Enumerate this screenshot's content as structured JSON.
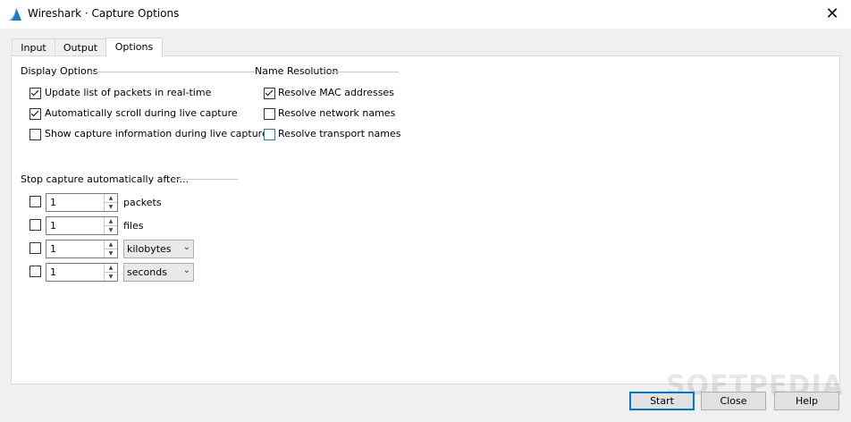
{
  "window": {
    "title": "Wireshark · Capture Options",
    "icon": "wireshark-fin-icon",
    "close_label": "✕"
  },
  "tabs": [
    {
      "label": "Input",
      "active": false
    },
    {
      "label": "Output",
      "active": false
    },
    {
      "label": "Options",
      "active": true
    }
  ],
  "display_options": {
    "title": "Display Options",
    "items": [
      {
        "label": "Update list of packets in real-time",
        "checked": true
      },
      {
        "label": "Automatically scroll during live capture",
        "checked": true
      },
      {
        "label": "Show capture information during live capture",
        "checked": false
      }
    ]
  },
  "name_resolution": {
    "title": "Name Resolution",
    "items": [
      {
        "label": "Resolve MAC addresses",
        "checked": true
      },
      {
        "label": "Resolve network names",
        "checked": false
      },
      {
        "label": "Resolve transport names",
        "checked": false
      }
    ]
  },
  "stop_capture": {
    "title": "Stop capture automatically after...",
    "rows": [
      {
        "checked": false,
        "value": "1",
        "unit": "packets"
      },
      {
        "checked": false,
        "value": "1",
        "unit": "files"
      },
      {
        "checked": false,
        "value": "1",
        "unit": "kilobytes",
        "unit_is_select": true
      },
      {
        "checked": false,
        "value": "1",
        "unit": "seconds",
        "unit_is_select": true
      }
    ]
  },
  "buttons": {
    "start": "Start",
    "close": "Close",
    "help": "Help"
  },
  "watermark": "SOFTPEDIA",
  "colors": {
    "default_button_border": "#0078d7",
    "focus_checkbox": "#1979ca"
  }
}
